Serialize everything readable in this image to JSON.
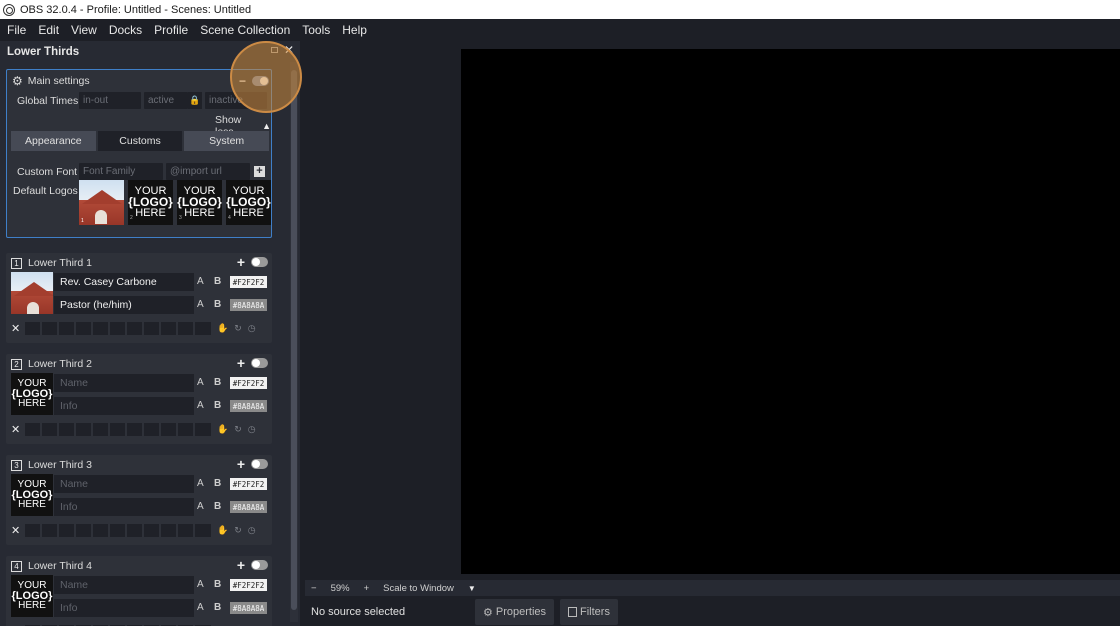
{
  "window": {
    "title": "OBS 32.0.4 - Profile: Untitled - Scenes: Untitled"
  },
  "menu": [
    "File",
    "Edit",
    "View",
    "Docks",
    "Profile",
    "Scene Collection",
    "Tools",
    "Help"
  ],
  "dock": {
    "title": "Lower Thirds",
    "main_settings": {
      "title": "Main settings",
      "global_times_label": "Global Times",
      "inout_placeholder": "in-out",
      "active_placeholder": "active",
      "inactive_placeholder": "inactive",
      "show_less": "Show less",
      "tabs": [
        "Appearance",
        "Customs",
        "System"
      ],
      "active_tab": "Customs",
      "custom_font_label": "Custom Font",
      "font_family_placeholder": "Font Family",
      "import_url_placeholder": "@import url",
      "default_logos_label": "Default Logos",
      "logo_tile": {
        "line1": "YOUR",
        "line2": "{LOGO}",
        "line3": "HERE"
      },
      "logo_numbers": [
        "1",
        "2",
        "3",
        "4"
      ]
    },
    "lower_thirds": [
      {
        "num": "1",
        "title": "Lower Third 1",
        "name": "Rev. Casey Carbone",
        "info": "Pastor (he/him)",
        "name_color": "#F2F2F2",
        "info_color": "#8A8A8A",
        "has_photo": true,
        "enabled": false
      },
      {
        "num": "2",
        "title": "Lower Third 2",
        "name": "",
        "info": "",
        "name_placeholder": "Name",
        "info_placeholder": "Info",
        "name_color": "#F2F2F2",
        "info_color": "#8A8A8A",
        "has_photo": false,
        "enabled": false
      },
      {
        "num": "3",
        "title": "Lower Third 3",
        "name": "",
        "info": "",
        "name_placeholder": "Name",
        "info_placeholder": "Info",
        "name_color": "#F2F2F2",
        "info_color": "#8A8A8A",
        "has_photo": false,
        "enabled": false
      },
      {
        "num": "4",
        "title": "Lower Third 4",
        "name": "",
        "info": "",
        "name_placeholder": "Name",
        "info_placeholder": "Info",
        "name_color": "#F2F2F2",
        "info_color": "#8A8A8A",
        "has_photo": false,
        "enabled": false
      }
    ]
  },
  "preview": {
    "zoom_minus": "−",
    "zoom_level": "59%",
    "zoom_plus": "+",
    "scale_mode": "Scale to Window"
  },
  "bottom": {
    "no_source": "No source selected",
    "properties": "Properties",
    "filters": "Filters"
  },
  "colors": {
    "accent": "#3f7fc8",
    "highlight": "#cc8b45",
    "panel": "#2e3139"
  }
}
